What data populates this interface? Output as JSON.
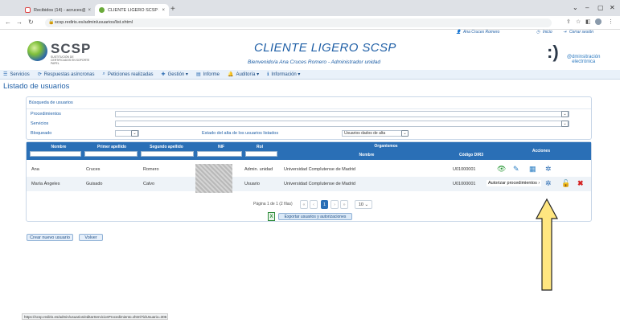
{
  "browser": {
    "tabs": [
      {
        "title": "Recibidos (14) - acruces@ucm.es",
        "active": false
      },
      {
        "title": "CLIENTE LIGERO SCSP > Listado",
        "active": true
      }
    ],
    "url": "scsp.rediris.es/admin/usuarios/list.xhtml",
    "status_url": "https://scsp.rediris.es/admin/usuarios/editarServiciosProcedimiento.xhtml?idUsuario=306"
  },
  "header": {
    "logo_text": "SCSP",
    "logo_subtitle": "SUSTITUCIÓN DE CERTIFICADOS EN SOPORTE PAPEL",
    "app_title": "CLIENTE LIGERO SCSP",
    "welcome": "Bienvenido/a Ana Cruces Romero - Administrador unidad",
    "user_link": "Ana Cruces Romero",
    "home_link": "Inicio",
    "logout_link": "Cerrar sesión",
    "brand_mark": ":)",
    "brand_text_1": "@dminsitración",
    "brand_text_2": "electrónica"
  },
  "menu": [
    {
      "icon": "list-icon",
      "label": "Servicios"
    },
    {
      "icon": "refresh-icon",
      "label": "Respuestas asíncronas"
    },
    {
      "icon": "search-icon",
      "label": "Peticiones realizadas"
    },
    {
      "icon": "plus-icon",
      "label": "Gestión ▾"
    },
    {
      "icon": "document-icon",
      "label": "Informe"
    },
    {
      "icon": "bell-icon",
      "label": "Auditoría ▾"
    },
    {
      "icon": "info-icon",
      "label": "Información ▾"
    }
  ],
  "page_title": "Listado de usuarios",
  "search": {
    "heading": "Búsqueda de usuarios",
    "procedimientos_label": "Procedimientos",
    "servicios_label": "Servicios",
    "bloqueado_label": "Bloqueado",
    "estado_label": "Estado del alta de los usuarios listados",
    "estado_value": "Usuarios dados de alta"
  },
  "table": {
    "headers": {
      "nombre": "Nombre",
      "apellido1": "Primer apellido",
      "apellido2": "Segundo apellido",
      "nif": "NIF",
      "rol": "Rol",
      "organismos": "Organismos",
      "org_nombre": "Nombre",
      "org_codigo": "Código DIR3",
      "acciones": "Acciones"
    },
    "rows": [
      {
        "nombre": "Ana",
        "apellido1": "Cruces",
        "apellido2": "Romero",
        "rol": "Admin. unidad",
        "organismo": "Universidad Complutense de Madrid",
        "codigo": "U01000001"
      },
      {
        "nombre": "María Ángeles",
        "apellido1": "Guisado",
        "apellido2": "Calvo",
        "rol": "Usuario",
        "organismo": "Universidad Complutense de Madrid",
        "codigo": "U01000001"
      }
    ],
    "tooltip": "Autorizar procedimientos",
    "pager_text": "Página 1 de 1 (2 filas)",
    "current_page": "1",
    "page_size": "10",
    "export_label": "Exportar usuarios y autorizaciones"
  },
  "buttons": {
    "new_user": "Crear nuevo usuario",
    "back": "Volver"
  },
  "colors": {
    "primary": "#2a6fb6",
    "title_blue": "#1f5fa6",
    "arrow_yellow": "#ffe680"
  }
}
